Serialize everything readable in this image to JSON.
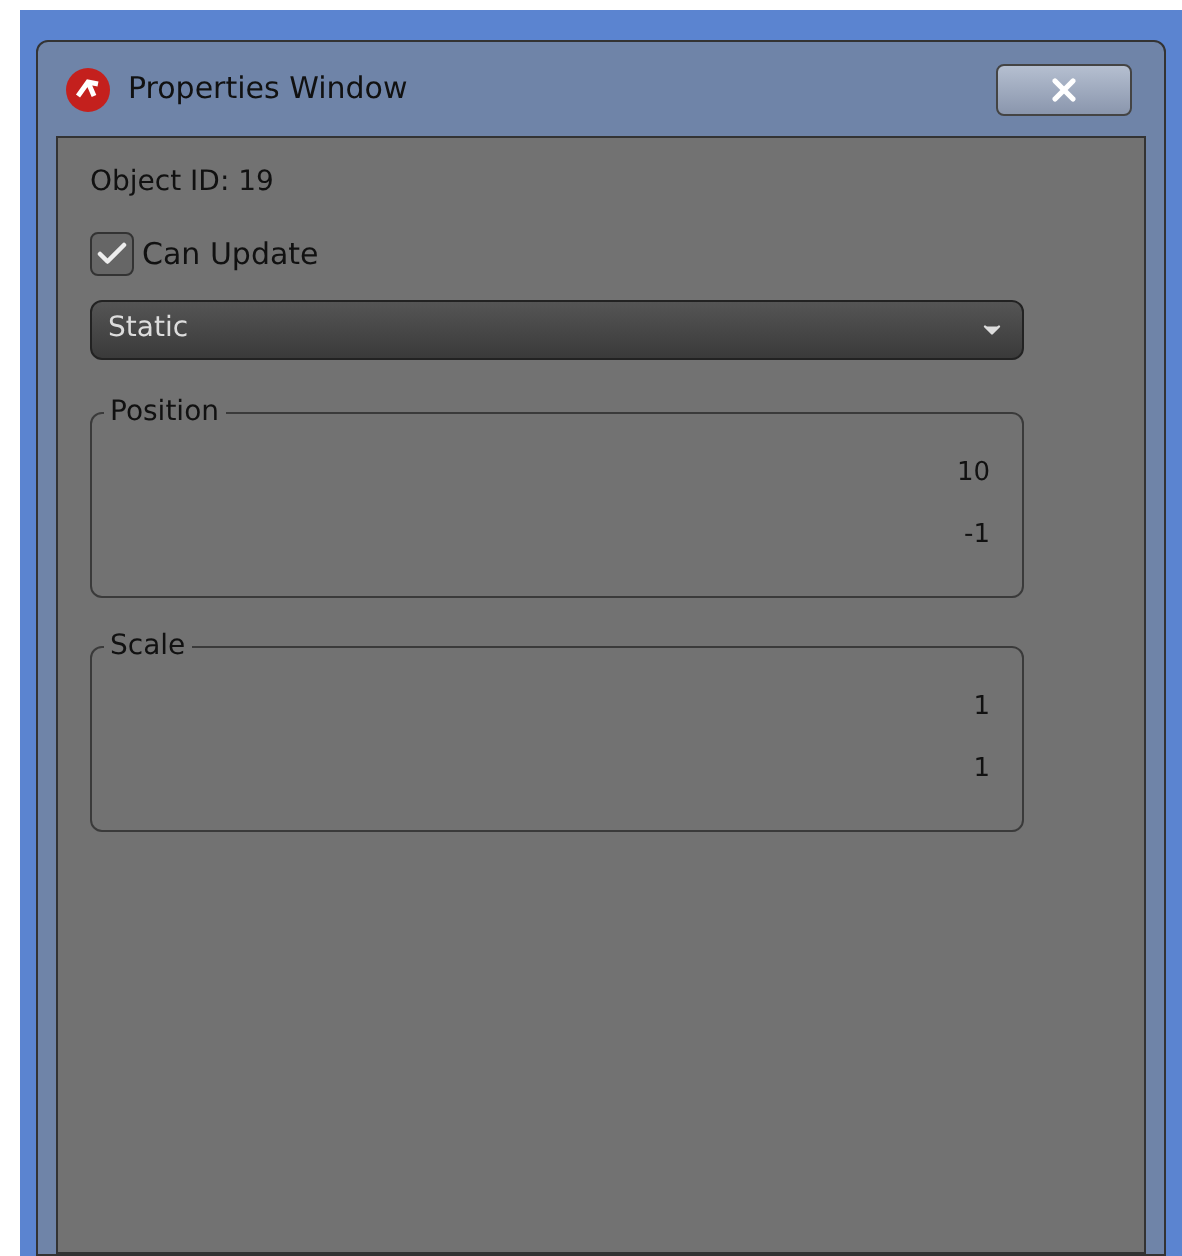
{
  "window": {
    "title": "Properties Window"
  },
  "object_id": "Object ID: 19",
  "can_update": {
    "label": "Can Update",
    "checked": true
  },
  "mode_dropdown": {
    "value": "Static"
  },
  "groups": [
    {
      "title": "Position",
      "values": [
        "10",
        "-1"
      ]
    },
    {
      "title": "Scale",
      "values": [
        "1",
        "1"
      ]
    }
  ]
}
